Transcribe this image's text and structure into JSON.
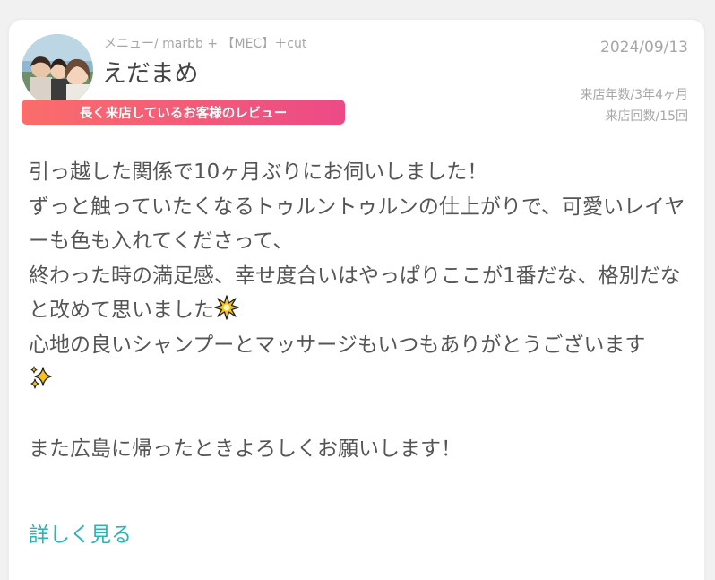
{
  "review": {
    "menu": "メニュー/ marbb + 【MEC】＋cut",
    "user_name": "えだまめ",
    "date": "2024/09/13",
    "badge": "長く来店しているお客様のレビュー",
    "visit_years": "来店年数/3年4ヶ月",
    "visit_count": "来店回数/15回",
    "body": {
      "line1": "引っ越した関係で10ヶ月ぶりにお伺いしました！",
      "line2": "ずっと触っていたくなるトゥルントゥルンの仕上がりで、可愛いレイヤーも色も入れてくださって、",
      "line3": "終わった時の満足感、幸せ度合いはやっぱりここが1番だな、格別だなと改めて思いました",
      "line4": "心地の良いシャンプーとマッサージもいつもありがとうございます",
      "line5": "また広島に帰ったときよろしくお願いします！"
    },
    "read_more": "詳しく見る"
  },
  "colors": {
    "badge_start": "#fb6d6b",
    "badge_end": "#ec4a86",
    "link": "#2fb3b3",
    "body_text": "#555555",
    "meta_text": "#a6a6a6"
  },
  "icons": {
    "line3_end": "sparkle-burst-icon",
    "line4_end": "sparkles-icon"
  }
}
